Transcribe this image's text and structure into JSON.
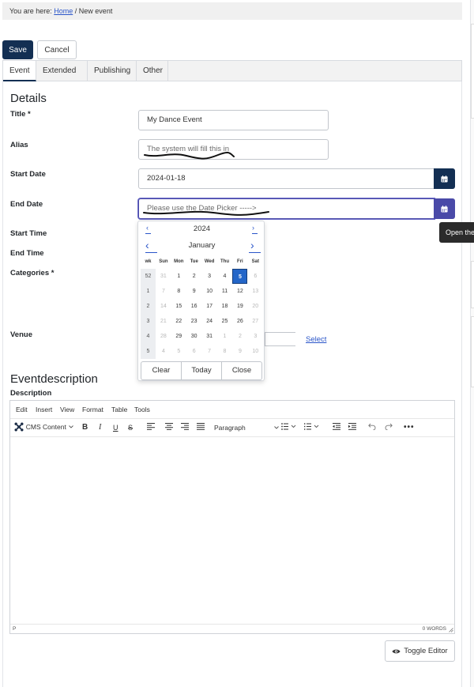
{
  "breadcrumb": {
    "prefix": "You are here:",
    "home": "Home",
    "separator": "/",
    "current": "New event"
  },
  "toolbar": {
    "save_label": "Save",
    "cancel_label": "Cancel"
  },
  "tabs": [
    {
      "label": "Event",
      "active": true
    },
    {
      "label": "Extended",
      "active": false
    },
    {
      "label": "Publishing",
      "active": false
    },
    {
      "label": "Other",
      "active": false
    }
  ],
  "details": {
    "heading": "Details",
    "title": {
      "label": "Title *",
      "value": "My Dance Event"
    },
    "alias": {
      "label": "Alias",
      "placeholder": "The system will fill this in"
    },
    "start_date": {
      "label": "Start Date",
      "value": "2024-01-18"
    },
    "end_date": {
      "label": "End Date",
      "placeholder": "Please use the Date Picker ----->"
    },
    "start_time": {
      "label": "Start Time"
    },
    "end_time": {
      "label": "End Time"
    },
    "categories": {
      "label": "Categories *"
    },
    "venue": {
      "label": "Venue",
      "select_label": "Select"
    }
  },
  "tooltip": {
    "text": "Open the"
  },
  "datepicker": {
    "year": "2024",
    "month": "January",
    "prev_year": "‹",
    "next_year": "›",
    "prev_month": "‹",
    "next_month": "›",
    "headers": [
      "wk",
      "Sun",
      "Mon",
      "Tue",
      "Wed",
      "Thu",
      "Fri",
      "Sat"
    ],
    "rows": [
      {
        "wk": "52",
        "days": [
          [
            "31",
            true
          ],
          [
            "1",
            false
          ],
          [
            "2",
            false
          ],
          [
            "3",
            false
          ],
          [
            "4",
            false
          ],
          [
            "5",
            false
          ],
          [
            "6",
            true
          ]
        ]
      },
      {
        "wk": "1",
        "days": [
          [
            "7",
            true
          ],
          [
            "8",
            false
          ],
          [
            "9",
            false
          ],
          [
            "10",
            false
          ],
          [
            "11",
            false
          ],
          [
            "12",
            false
          ],
          [
            "13",
            true
          ]
        ]
      },
      {
        "wk": "2",
        "days": [
          [
            "14",
            true
          ],
          [
            "15",
            false
          ],
          [
            "16",
            false
          ],
          [
            "17",
            false
          ],
          [
            "18",
            false
          ],
          [
            "19",
            false
          ],
          [
            "20",
            true
          ]
        ]
      },
      {
        "wk": "3",
        "days": [
          [
            "21",
            true
          ],
          [
            "22",
            false
          ],
          [
            "23",
            false
          ],
          [
            "24",
            false
          ],
          [
            "25",
            false
          ],
          [
            "26",
            false
          ],
          [
            "27",
            true
          ]
        ]
      },
      {
        "wk": "4",
        "days": [
          [
            "28",
            true
          ],
          [
            "29",
            false
          ],
          [
            "30",
            false
          ],
          [
            "31",
            false
          ],
          [
            "1",
            true
          ],
          [
            "2",
            true
          ],
          [
            "3",
            true
          ]
        ]
      },
      {
        "wk": "5",
        "days": [
          [
            "4",
            true
          ],
          [
            "5",
            true
          ],
          [
            "6",
            true
          ],
          [
            "7",
            true
          ],
          [
            "8",
            true
          ],
          [
            "9",
            true
          ],
          [
            "10",
            true
          ]
        ]
      }
    ],
    "selected_day": "5",
    "clear_label": "Clear",
    "today_label": "Today",
    "close_label": "Close"
  },
  "eventdescription": {
    "heading": "Eventdescription",
    "label": "Description",
    "menu": [
      "Edit",
      "Insert",
      "View",
      "Format",
      "Table",
      "Tools"
    ],
    "cms_content_label": "CMS Content",
    "paragraph_label": "Paragraph",
    "status_path": "P",
    "word_count": "0 WORDS",
    "toggle_editor_label": "Toggle Editor"
  },
  "colors": {
    "primary": "#132f53",
    "accent": "#4a4aa8",
    "link": "#2a55c9",
    "selected": "#2466c8"
  }
}
